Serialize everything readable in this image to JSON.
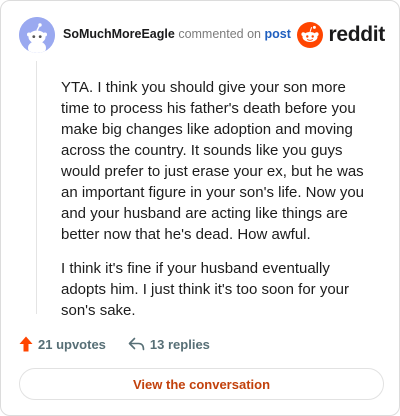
{
  "header": {
    "username": "SoMuchMoreEagle",
    "action_text": "commented on",
    "post_link": "post",
    "logo_text": "reddit",
    "avatar_icon": "snoo-avatar-icon",
    "logo_icon": "reddit-alien-icon"
  },
  "comment": {
    "paragraphs": [
      "YTA. I think you should give your son more time to process his father's death before you make big changes like adoption and moving across the country. It sounds like you guys would prefer to just erase your ex, but he was an important figure in your son's life. Now you and your husband are acting like things are better now that he's dead. How awful.",
      "I think it's fine if your husband eventually adopts him. I just think it's too soon for your son's sake."
    ]
  },
  "actions": {
    "upvotes": "21 upvotes",
    "upvote_icon": "upvote-arrow-icon",
    "replies": "13 replies",
    "reply_icon": "reply-arrow-icon"
  },
  "footer": {
    "button_label": "View the conversation"
  },
  "colors": {
    "brand": "#ff4500",
    "link": "#1f5fbf",
    "button_text": "#c2410c",
    "avatar_bg": "#9aa9f0"
  }
}
